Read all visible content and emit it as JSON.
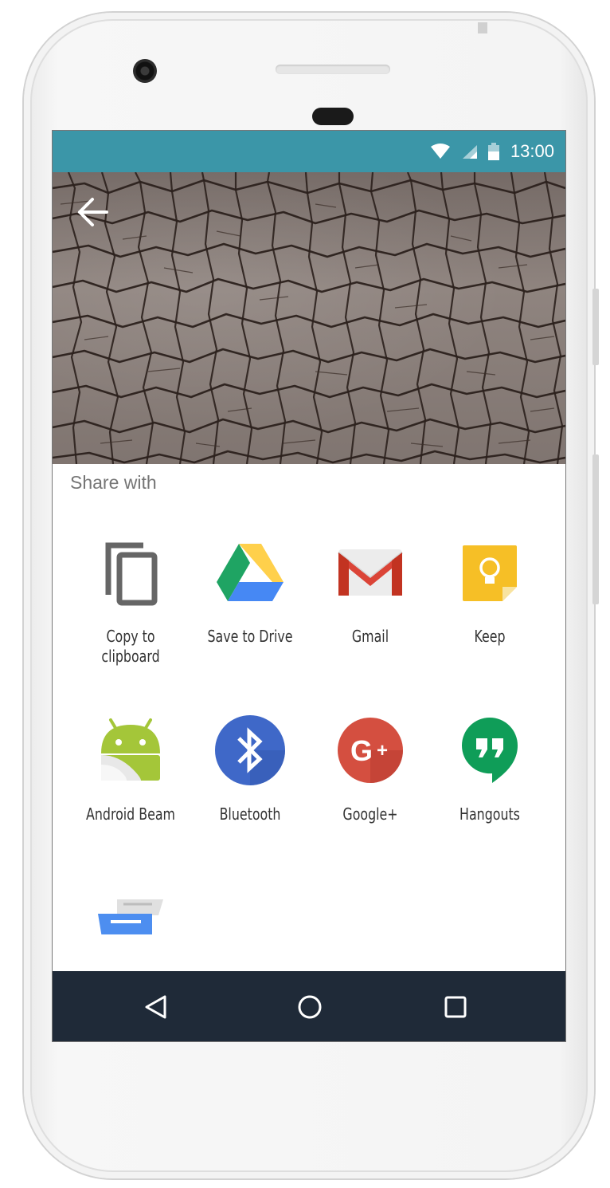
{
  "status_bar": {
    "time": "13:00",
    "icons": [
      "wifi-icon",
      "cell-signal-icon",
      "battery-icon"
    ],
    "background": "#3b96a8"
  },
  "header": {
    "back_icon": "arrow-back-icon",
    "image": "dry cracked earth"
  },
  "share": {
    "title": "Share with",
    "items": [
      {
        "label": "Copy to\nclipboard",
        "icon": "copy-icon"
      },
      {
        "label": "Save to Drive",
        "icon": "google-drive-icon"
      },
      {
        "label": "Gmail",
        "icon": "gmail-icon"
      },
      {
        "label": "Keep",
        "icon": "keep-icon"
      },
      {
        "label": "Android Beam",
        "icon": "android-beam-icon"
      },
      {
        "label": "Bluetooth",
        "icon": "bluetooth-icon"
      },
      {
        "label": "Google+",
        "icon": "google-plus-icon"
      },
      {
        "label": "Hangouts",
        "icon": "hangouts-icon"
      },
      {
        "label": "",
        "icon": "messages-icon"
      }
    ]
  },
  "nav_bar": {
    "buttons": [
      "back-triangle-icon",
      "home-circle-icon",
      "recents-square-icon"
    ],
    "background": "#1f2a38"
  },
  "colors": {
    "drive_green": "#1fa463",
    "drive_yellow": "#ffd04b",
    "drive_blue": "#4688f4",
    "gmail_red": "#db4437",
    "keep_yellow": "#f6bf26",
    "android_green": "#a4c639",
    "bluetooth_blue": "#3f68c8",
    "gplus_red": "#d44f40",
    "hangouts_green": "#0f9d58"
  }
}
